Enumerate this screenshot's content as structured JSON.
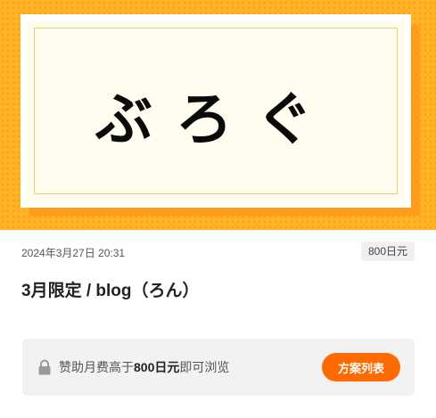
{
  "cover": {
    "title": "ぶろぐ"
  },
  "post": {
    "date": "2024年3月27日 20:31",
    "price_badge": "800日元",
    "title": "3月限定 / blog（ろん）"
  },
  "lock_notice": {
    "icon": "lock-icon",
    "text_prefix": "赞助月费高于",
    "text_amount": "800日元",
    "text_suffix": "即可浏览",
    "button_label": "方案列表"
  },
  "colors": {
    "accent": "#ff6a00",
    "cover_background": "#ffb326",
    "cover_panel": "#fffdf0"
  }
}
